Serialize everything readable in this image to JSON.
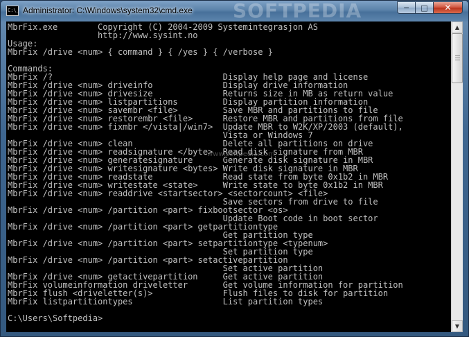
{
  "window": {
    "title": "Administrator: C:\\Windows\\system32\\cmd.exe",
    "icon": "cmd-icon",
    "icon_text": "C:\\_",
    "watermark": "SOFTPEDIA",
    "buttons": {
      "minimize": "─",
      "maximize": "□",
      "close": "✕"
    }
  },
  "console": {
    "watermark": "www.softpedia.com",
    "lines": [
      "MbrFix.exe        Copyright (C) 2004-2009 Systemintegrasjon AS",
      "                  http://www.sysint.no",
      "Usage:",
      "MbrFix /drive <num> { command } { /yes } { /verbose }",
      "",
      "Commands:",
      "MbrFix /?                                  Display help page and license",
      "MbrFix /drive <num> driveinfo              Display drive information",
      "MbrFix /drive <num> drivesize              Returns size in MB as return value",
      "MbrFix /drive <num> listpartitions         Display partition information",
      "MbrFix /drive <num> savembr <file>         Save MBR and partitions to file",
      "MbrFix /drive <num> restorembr <file>      Restore MBR and partitions from file",
      "MbrFix /drive <num> fixmbr </vista|/win7>  Update MBR to W2K/XP/2003 (default),",
      "                                           Vista or Windows 7",
      "MbrFix /drive <num> clean                  Delete all partitions on drive",
      "MbrFix /drive <num> readsignature </byte>  Read disk signature from MBR",
      "MbrFix /drive <num> generatesignature      Generate disk signature in MBR",
      "MbrFix /drive <num> writesignature <bytes> Write disk signature in MBR",
      "MbrFix /drive <num> readstate              Read state from byte 0x1b2 in MBR",
      "MbrFix /drive <num> writestate <state>     Write state to byte 0x1b2 in MBR",
      "MbrFix /drive <num> readdrive <startsector> <sectorcount> <file>",
      "                                           Save sectors from drive to file",
      "MbrFix /drive <num> /partition <part> fixbootsector <os>",
      "                                           Update Boot code in boot sector",
      "MbrFix /drive <num> /partition <part> getpartitiontype",
      "                                           Get partition type",
      "MbrFix /drive <num> /partition <part> setpartitiontype <typenum>",
      "                                           Set partition type",
      "MbrFix /drive <num> /partition <part> setactivepartition",
      "                                           Set active partition",
      "MbrFix /drive <num> getactivepartition     Get active partition",
      "MbrFix volumeinformation driveletter       Get volume information for partition",
      "MbrFix flush <driveletter(s)>              Flush files to disk for partition",
      "MbrFix listpartitiontypes                  List partition types",
      "",
      "C:\\Users\\Softpedia>"
    ]
  },
  "scrollbar": {
    "up_arrow": "▲",
    "down_arrow": "▼"
  }
}
